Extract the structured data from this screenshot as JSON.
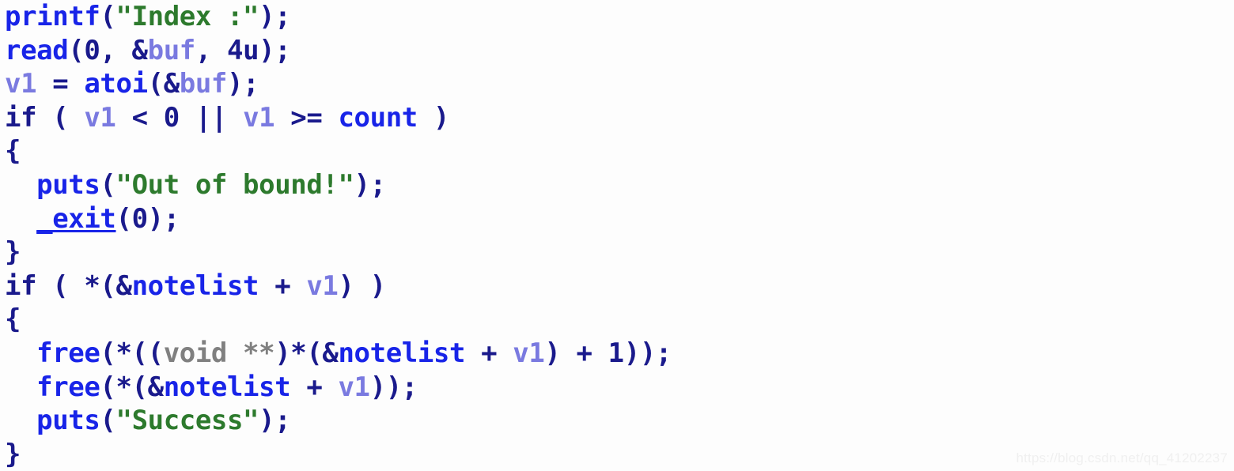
{
  "app": {
    "kind": "ida-hexrays-pseudocode",
    "background_color": "#fdfdfd"
  },
  "palette": {
    "function": "#1824e8",
    "variable": "#7a7ae0",
    "punctuation": "#1a1a8c",
    "string": "#2d7a2d",
    "type": "#808080",
    "watermark": "#f0f0f0"
  },
  "code": {
    "language": "c",
    "lines": [
      {
        "index": 0,
        "indent": "",
        "text": "printf(\"Index :\");",
        "tokens": [
          {
            "t": "printf",
            "c": "tok-func"
          },
          {
            "t": "(",
            "c": "tok-punct"
          },
          {
            "t": "\"Index :\"",
            "c": "tok-str"
          },
          {
            "t": ");",
            "c": "tok-punct"
          }
        ]
      },
      {
        "index": 1,
        "indent": "",
        "text": "read(0, &buf, 4u);",
        "tokens": [
          {
            "t": "read",
            "c": "tok-func"
          },
          {
            "t": "(0, &",
            "c": "tok-punct"
          },
          {
            "t": "buf",
            "c": "tok-var"
          },
          {
            "t": ", 4u);",
            "c": "tok-punct"
          }
        ]
      },
      {
        "index": 2,
        "indent": "",
        "text": "v1 = atoi(&buf);",
        "tokens": [
          {
            "t": "v1",
            "c": "tok-var"
          },
          {
            "t": " = ",
            "c": "tok-punct"
          },
          {
            "t": "atoi",
            "c": "tok-func"
          },
          {
            "t": "(&",
            "c": "tok-punct"
          },
          {
            "t": "buf",
            "c": "tok-var"
          },
          {
            "t": ");",
            "c": "tok-punct"
          }
        ]
      },
      {
        "index": 3,
        "indent": "",
        "text": "if ( v1 < 0 || v1 >= count )",
        "tokens": [
          {
            "t": "if ( ",
            "c": "tok-punct"
          },
          {
            "t": "v1",
            "c": "tok-var"
          },
          {
            "t": " < 0 || ",
            "c": "tok-punct"
          },
          {
            "t": "v1",
            "c": "tok-var"
          },
          {
            "t": " >= ",
            "c": "tok-punct"
          },
          {
            "t": "count",
            "c": "tok-func"
          },
          {
            "t": " )",
            "c": "tok-punct"
          }
        ]
      },
      {
        "index": 4,
        "indent": "",
        "text": "{",
        "tokens": [
          {
            "t": "{",
            "c": "tok-punct"
          }
        ]
      },
      {
        "index": 5,
        "indent": "  ",
        "text": "puts(\"Out of bound!\");",
        "tokens": [
          {
            "t": "  ",
            "c": "tok-punct"
          },
          {
            "t": "puts",
            "c": "tok-func"
          },
          {
            "t": "(",
            "c": "tok-punct"
          },
          {
            "t": "\"Out of bound!\"",
            "c": "tok-str"
          },
          {
            "t": ");",
            "c": "tok-punct"
          }
        ]
      },
      {
        "index": 6,
        "indent": "  ",
        "text": "_exit(0);",
        "tokens": [
          {
            "t": "  ",
            "c": "tok-punct"
          },
          {
            "t": "_exit",
            "c": "tok-func tok-under"
          },
          {
            "t": "(0);",
            "c": "tok-punct"
          }
        ]
      },
      {
        "index": 7,
        "indent": "",
        "text": "}",
        "tokens": [
          {
            "t": "}",
            "c": "tok-punct"
          }
        ]
      },
      {
        "index": 8,
        "indent": "",
        "text": "if ( *(&notelist + v1) )",
        "tokens": [
          {
            "t": "if ( *(&",
            "c": "tok-punct"
          },
          {
            "t": "notelist",
            "c": "tok-func"
          },
          {
            "t": " + ",
            "c": "tok-punct"
          },
          {
            "t": "v1",
            "c": "tok-var"
          },
          {
            "t": ") )",
            "c": "tok-punct"
          }
        ]
      },
      {
        "index": 9,
        "indent": "",
        "text": "{",
        "tokens": [
          {
            "t": "{",
            "c": "tok-punct"
          }
        ]
      },
      {
        "index": 10,
        "indent": "  ",
        "text": "free(*((void **)*(&notelist + v1) + 1));",
        "tokens": [
          {
            "t": "  ",
            "c": "tok-punct"
          },
          {
            "t": "free",
            "c": "tok-func"
          },
          {
            "t": "(*((",
            "c": "tok-punct"
          },
          {
            "t": "void **",
            "c": "tok-type"
          },
          {
            "t": ")*(&",
            "c": "tok-punct"
          },
          {
            "t": "notelist",
            "c": "tok-func"
          },
          {
            "t": " + ",
            "c": "tok-punct"
          },
          {
            "t": "v1",
            "c": "tok-var"
          },
          {
            "t": ") + 1));",
            "c": "tok-punct"
          }
        ]
      },
      {
        "index": 11,
        "indent": "  ",
        "text": "free(*(&notelist + v1));",
        "tokens": [
          {
            "t": "  ",
            "c": "tok-punct"
          },
          {
            "t": "free",
            "c": "tok-func"
          },
          {
            "t": "(*(&",
            "c": "tok-punct"
          },
          {
            "t": "notelist",
            "c": "tok-func"
          },
          {
            "t": " + ",
            "c": "tok-punct"
          },
          {
            "t": "v1",
            "c": "tok-var"
          },
          {
            "t": "));",
            "c": "tok-punct"
          }
        ]
      },
      {
        "index": 12,
        "indent": "  ",
        "text": "puts(\"Success\");",
        "tokens": [
          {
            "t": "  ",
            "c": "tok-punct"
          },
          {
            "t": "puts",
            "c": "tok-func"
          },
          {
            "t": "(",
            "c": "tok-punct"
          },
          {
            "t": "\"Success\"",
            "c": "tok-str"
          },
          {
            "t": ");",
            "c": "tok-punct"
          }
        ]
      },
      {
        "index": 13,
        "indent": "",
        "text": "}",
        "tokens": [
          {
            "t": "}",
            "c": "tok-punct"
          }
        ]
      }
    ]
  },
  "watermark": {
    "text": "https://blog.csdn.net/qq_41202237"
  }
}
